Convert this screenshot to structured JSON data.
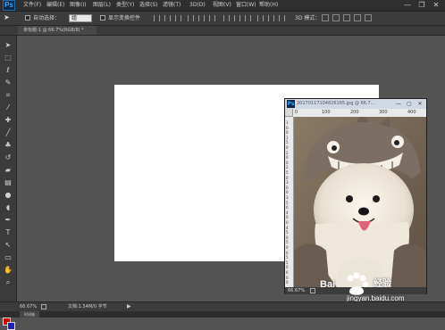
{
  "app": {
    "logo": "Ps",
    "menus": [
      "文件(F)",
      "编辑(E)",
      "图像(I)",
      "图层(L)",
      "类型(Y)",
      "选择(S)",
      "滤镜(T)",
      "3D(D)",
      "视图(V)",
      "窗口(W)",
      "帮助(H)"
    ],
    "window_controls": {
      "minimize": "—",
      "restore": "❐",
      "close": "✕"
    }
  },
  "options": {
    "auto_select_label": "自动选择：",
    "auto_select_value": "组",
    "transform_label": "显示变换控件",
    "mode_label": "3D 模式："
  },
  "document_tab": {
    "label": "未标题-1 @ 66.7%(RGB/8) *"
  },
  "image_window": {
    "title": "20170117104826165.jpg @ 66.7...",
    "ruler_h": [
      "0",
      "100",
      "200",
      "300",
      "400"
    ],
    "ruler_v": [
      "1",
      "0",
      "0",
      "1",
      "5",
      "0",
      "2",
      "0",
      "0",
      "2",
      "5",
      "0",
      "3",
      "0",
      "0",
      "3",
      "5",
      "0",
      "4",
      "0",
      "0",
      "4",
      "5",
      "0",
      "5",
      "0",
      "0",
      "5",
      "5",
      "0",
      "6",
      "0",
      "0"
    ],
    "zoom": "66.67%",
    "controls": {
      "minimize": "—",
      "restore": "▢",
      "close": "✕"
    }
  },
  "status": {
    "zoom": "66.67%",
    "doc_info": "文档:1.54M/0 字节"
  },
  "bottom_tab": {
    "label": "时间轴"
  },
  "watermark": {
    "site": "jingyan.baidu.com",
    "brand": "Bai",
    "brand_suffix": "经验"
  },
  "colors": {
    "foreground": "#d40000",
    "background": "#2020c0"
  }
}
